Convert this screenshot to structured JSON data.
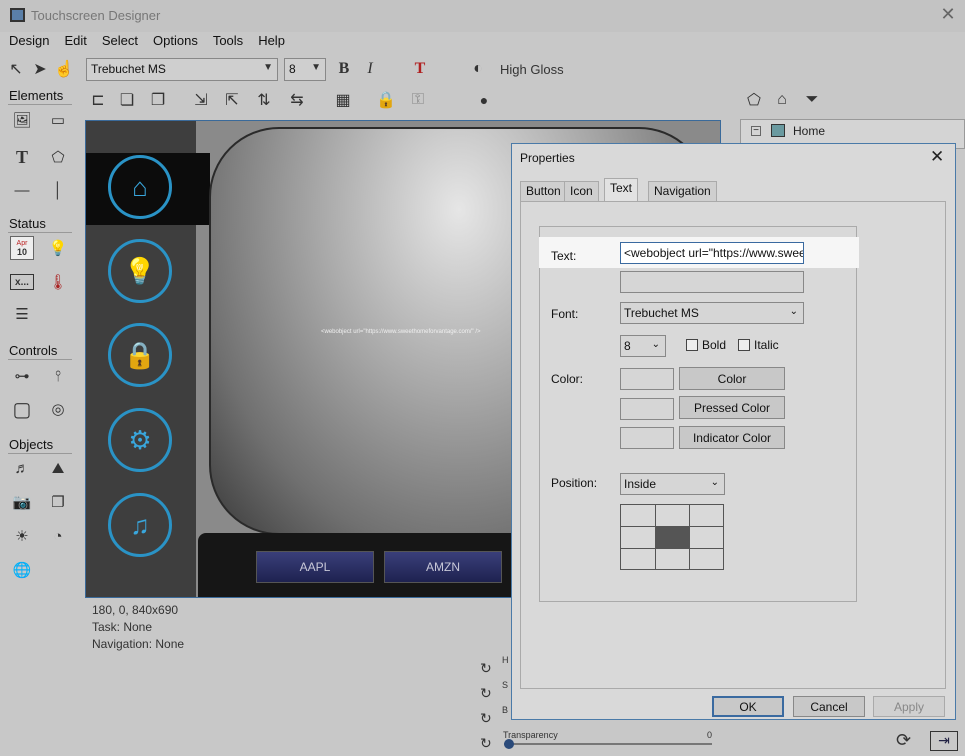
{
  "app": {
    "title": "Touchscreen Designer"
  },
  "menu": [
    "Design",
    "Edit",
    "Select",
    "Options",
    "Tools",
    "Help"
  ],
  "toolbar": {
    "font": "Trebuchet MS",
    "size": "8",
    "bold": "B",
    "italic": "I",
    "textcolor": "T",
    "gloss": "High Gloss"
  },
  "sections": {
    "elements": "Elements",
    "status": "Status",
    "controls": "Controls",
    "objects": "Objects"
  },
  "status_icon_text": "x...",
  "calendar": {
    "month": "Apr",
    "day": "10"
  },
  "canvas": {
    "tiny_text": "<webobject url=\"https://www.sweethomeforvantage.com/\" />",
    "stocks": [
      "AAPL",
      "AMZN"
    ]
  },
  "info": {
    "geom": "180, 0, 840x690",
    "task": "Task:  None",
    "nav": "Navigation:  None"
  },
  "tree": {
    "home": "Home"
  },
  "bottom": {
    "h": "H",
    "s": "S",
    "b": "B",
    "transparency": "Transparency",
    "value": "0"
  },
  "dialog": {
    "title": "Properties",
    "tabs": [
      "Button",
      "Icon",
      "Text",
      "Navigation"
    ],
    "text_label": "Text:",
    "text_value": "<webobject url=\"https://www.sweetho",
    "font_label": "Font:",
    "font_value": "Trebuchet MS",
    "size_value": "8",
    "bold": "Bold",
    "italic": "Italic",
    "color_label": "Color:",
    "color_btn": "Color",
    "pressed_btn": "Pressed Color",
    "indicator_btn": "Indicator Color",
    "position_label": "Position:",
    "position_value": "Inside",
    "ok": "OK",
    "cancel": "Cancel",
    "apply": "Apply"
  },
  "colors": {
    "accent": "#2a93c6",
    "dialog_border": "#4a7aa8"
  }
}
